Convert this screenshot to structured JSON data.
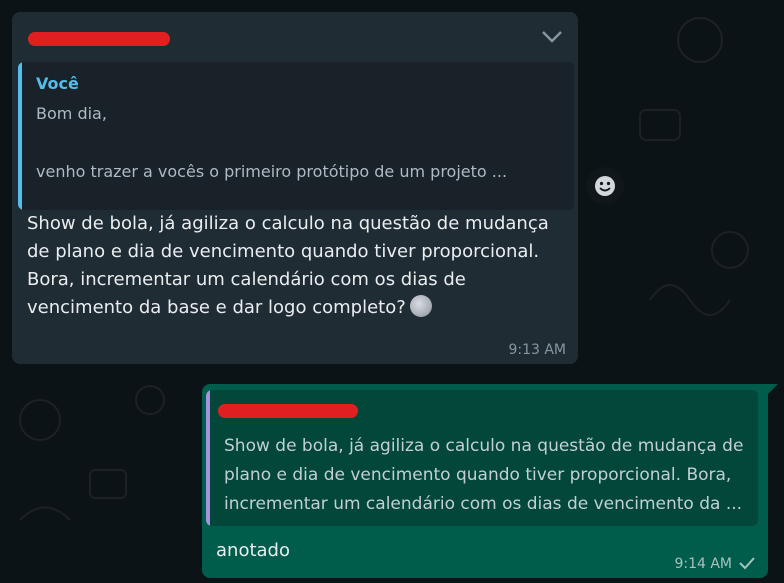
{
  "incoming": {
    "sender": "",
    "quote": {
      "author": "Você",
      "line1": "Bom dia,",
      "line2": "venho trazer a vocês o primeiro protótipo de um projeto ..."
    },
    "text": "Show de bola, já agiliza o calculo na questão de mudança de plano e dia de vencimento quando tiver proporcional. Bora, incrementar um calendário com os dias de vencimento da base e dar logo completo?",
    "emoji": "new-moon-face",
    "time": "9:13 AM"
  },
  "outgoing": {
    "quote": {
      "author": "",
      "text": "Show de bola, já agiliza o calculo na questão de mudança de plano e dia de vencimento quando tiver proporcional. Bora, incrementar um calendário com os dias de vencimento da ..."
    },
    "text": "anotado",
    "time": "9:14 AM",
    "status": "sent"
  },
  "colors": {
    "background": "#0c1317",
    "incoming_bubble": "#202c33",
    "outgoing_bubble": "#005c4b",
    "quote_accent_you": "#53bdeb",
    "quote_accent_other": "#a593e0",
    "redaction": "#e02020"
  },
  "icons": {
    "menu": "chevron-down-icon",
    "react": "emoji-react-icon",
    "status": "single-check-icon"
  }
}
